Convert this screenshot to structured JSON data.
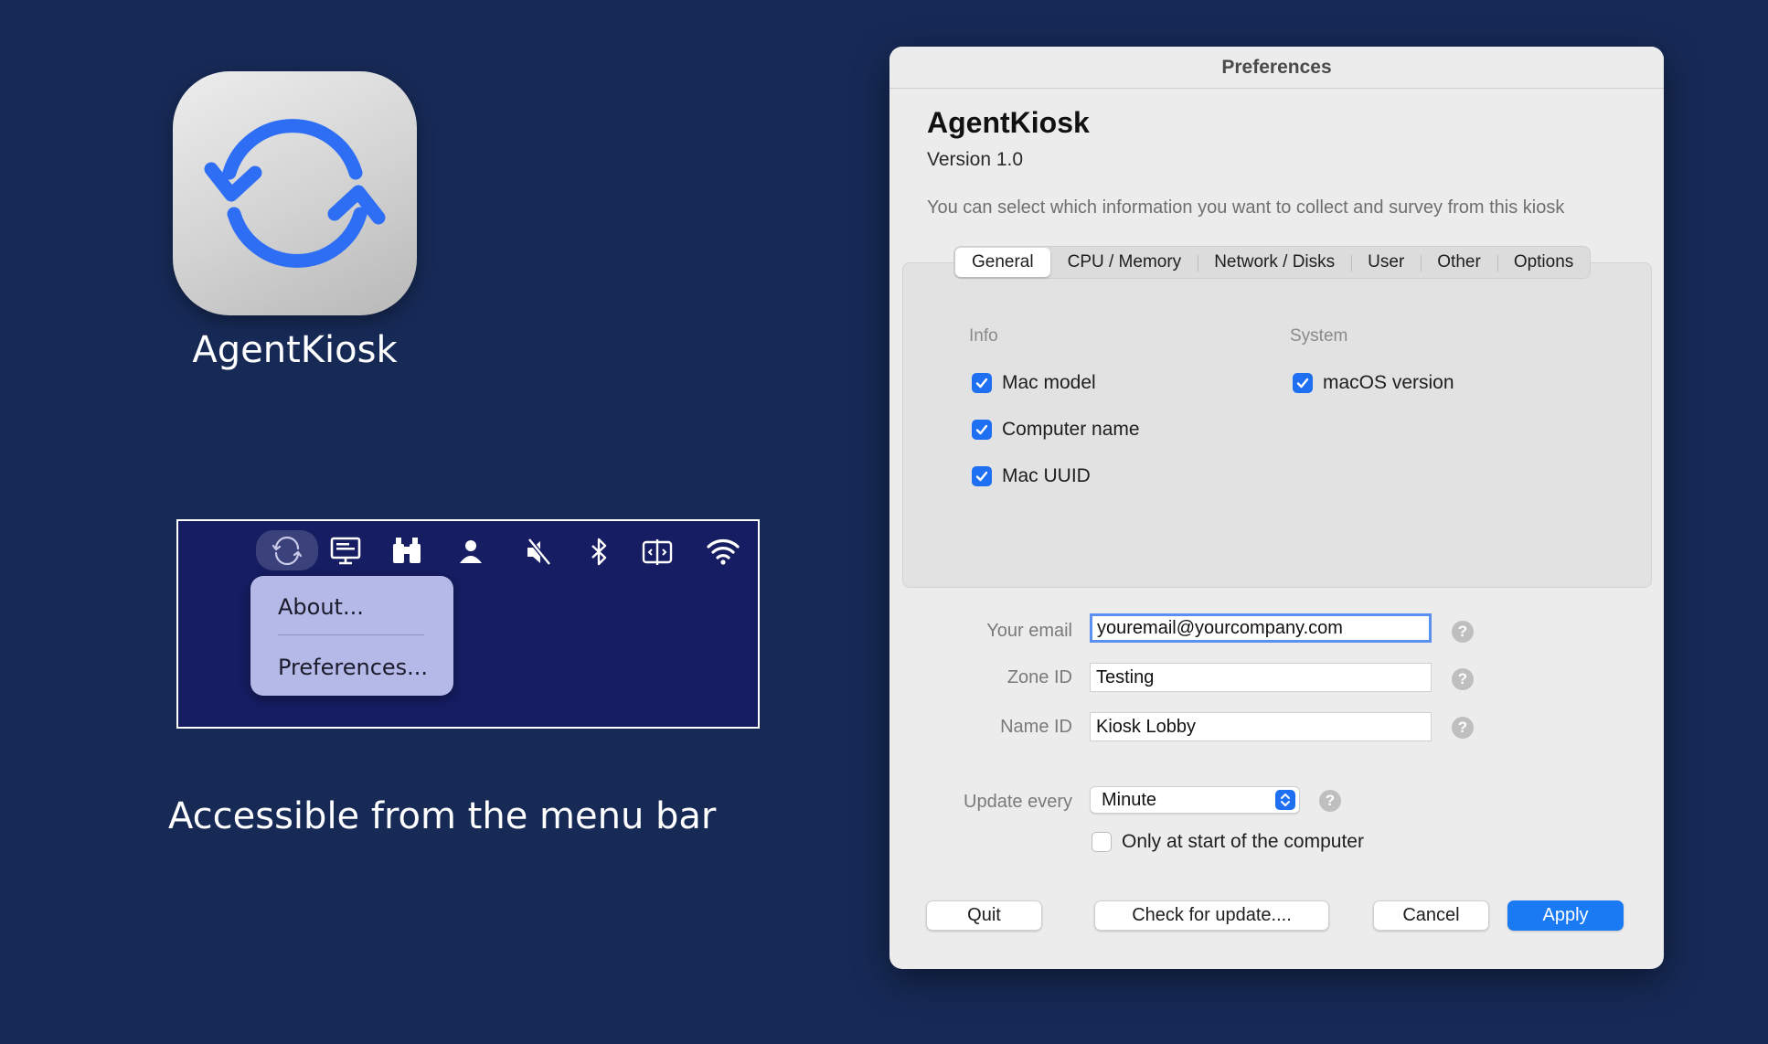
{
  "promo": {
    "app_name": "AgentKiosk",
    "caption": "Accessible from the menu bar",
    "icon": "sync-arrows-icon",
    "accent": "#2e6ef5"
  },
  "menubar": {
    "icons": [
      "sync-icon",
      "display-icon",
      "binoculars-icon",
      "user-icon",
      "mute-icon",
      "bluetooth-icon",
      "split-view-icon",
      "wifi-icon"
    ],
    "menu": {
      "about": "About...",
      "preferences": "Preferences..."
    }
  },
  "window": {
    "title": "Preferences",
    "app_title": "AgentKiosk",
    "version": "Version 1.0",
    "description": "You can select which information you want to collect and survey from this kiosk",
    "tabs": [
      {
        "label": "General",
        "active": true
      },
      {
        "label": "CPU / Memory",
        "active": false
      },
      {
        "label": "Network / Disks",
        "active": false
      },
      {
        "label": "User",
        "active": false
      },
      {
        "label": "Other",
        "active": false
      },
      {
        "label": "Options",
        "active": false
      }
    ],
    "info": {
      "heading": "Info",
      "items": [
        {
          "label": "Mac model",
          "checked": true
        },
        {
          "label": "Computer name",
          "checked": true
        },
        {
          "label": "Mac UUID",
          "checked": true
        }
      ]
    },
    "system": {
      "heading": "System",
      "items": [
        {
          "label": "macOS version",
          "checked": true
        }
      ]
    },
    "fields": {
      "email_label": "Your email",
      "email_value": "youremail@yourcompany.com",
      "zone_label": "Zone ID",
      "zone_value": "Testing",
      "name_label": "Name ID",
      "name_value": "Kiosk Lobby",
      "help_glyph": "?"
    },
    "update": {
      "label": "Update every",
      "selected": "Minute",
      "only_at_start_label": "Only at start of the computer",
      "only_at_start_checked": false
    },
    "buttons": {
      "quit": "Quit",
      "check_update": "Check for update....",
      "cancel": "Cancel",
      "apply": "Apply"
    }
  }
}
